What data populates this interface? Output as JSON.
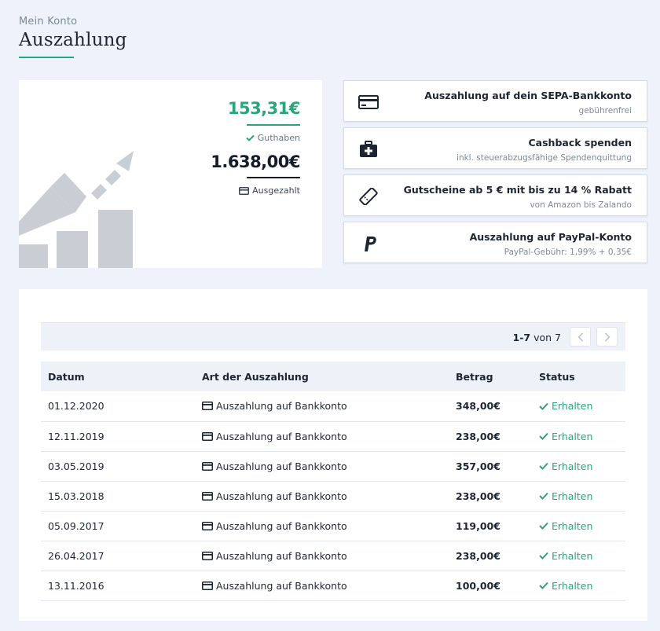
{
  "header": {
    "breadcrumb": "Mein Konto",
    "title": "Auszahlung"
  },
  "balance": {
    "credit_value": "153,31€",
    "credit_label": "Guthaben",
    "paid_value": "1.638,00€",
    "paid_label": "Ausgezahlt"
  },
  "options": [
    {
      "title": "Auszahlung auf dein SEPA-Bankkonto",
      "subtitle": "gebührenfrei",
      "icon": "credit-card-icon"
    },
    {
      "title": "Cashback spenden",
      "subtitle": "inkl. steuerabzugsfähige Spendenquittung",
      "icon": "medical-kit-icon"
    },
    {
      "title": "Gutscheine ab 5 € mit bis zu 14 % Rabatt",
      "subtitle": "von Amazon bis Zalando",
      "icon": "ticket-icon"
    },
    {
      "title": "Auszahlung auf PayPal-Konto",
      "subtitle": "PayPal-Gebühr: 1,99% + 0,35€",
      "icon": "paypal-icon"
    }
  ],
  "pager": {
    "range": "1-7",
    "of_label": "von",
    "total": "7"
  },
  "table": {
    "headers": {
      "date": "Datum",
      "type": "Art der Auszahlung",
      "amount": "Betrag",
      "status": "Status"
    },
    "rows": [
      {
        "date": "01.12.2020",
        "type": "Auszahlung auf Bankkonto",
        "amount": "348,00€",
        "status": "Erhalten"
      },
      {
        "date": "12.11.2019",
        "type": "Auszahlung auf Bankkonto",
        "amount": "238,00€",
        "status": "Erhalten"
      },
      {
        "date": "03.05.2019",
        "type": "Auszahlung auf Bankkonto",
        "amount": "357,00€",
        "status": "Erhalten"
      },
      {
        "date": "15.03.2018",
        "type": "Auszahlung auf Bankkonto",
        "amount": "238,00€",
        "status": "Erhalten"
      },
      {
        "date": "05.09.2017",
        "type": "Auszahlung auf Bankkonto",
        "amount": "119,00€",
        "status": "Erhalten"
      },
      {
        "date": "26.04.2017",
        "type": "Auszahlung auf Bankkonto",
        "amount": "238,00€",
        "status": "Erhalten"
      },
      {
        "date": "13.11.2016",
        "type": "Auszahlung auf Bankkonto",
        "amount": "100,00€",
        "status": "Erhalten"
      }
    ]
  },
  "colors": {
    "accent": "#2aa57a",
    "background": "#eef2fa",
    "dark_text": "#1c2633"
  }
}
